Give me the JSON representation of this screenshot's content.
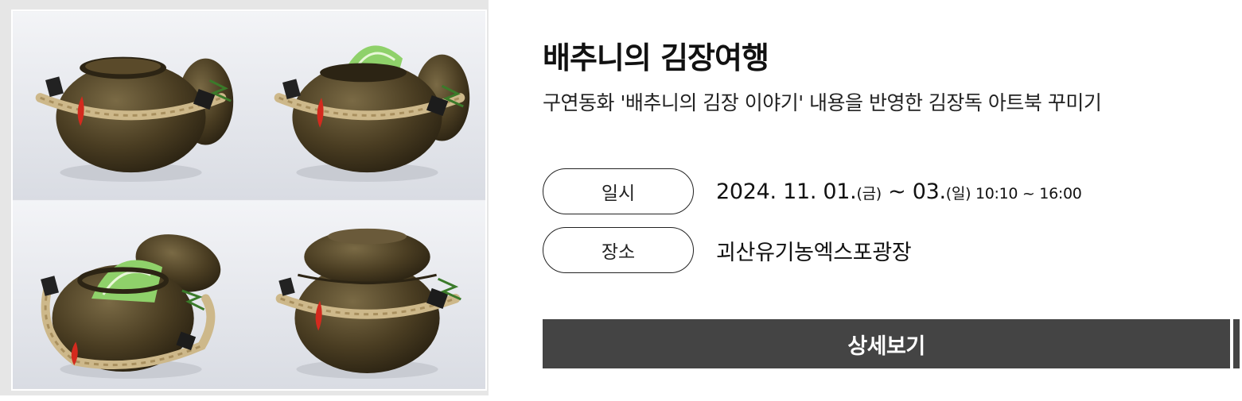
{
  "event": {
    "title": "배추니의 김장여행",
    "subtitle": "구연동화 '배추니의 김장 이야기' 내용을 반영한 김장독 아트북 꾸미기",
    "date_label": "일시",
    "date_main": "2024. 11. 01.",
    "date_start_day": "(금)",
    "date_sep": " ~ 03.",
    "date_end_day": "(일)",
    "date_time": " 10:10 ~ 16:00",
    "place_label": "장소",
    "place_value": "괴산유기농엑스포광장",
    "detail_button_label": "상세보기"
  },
  "colors": {
    "button_bg": "#444444",
    "pot": "#4a3d22",
    "rope": "#cdb88a",
    "cabbage": "#8fd16a",
    "chili": "#d42a1e",
    "photo_bg": "#eef0f4"
  },
  "photo": {
    "panels": [
      "pot-open-lid",
      "pot-cabbage-behind-lid",
      "pot-cabbage-lid-tilted",
      "pot-closed"
    ]
  }
}
